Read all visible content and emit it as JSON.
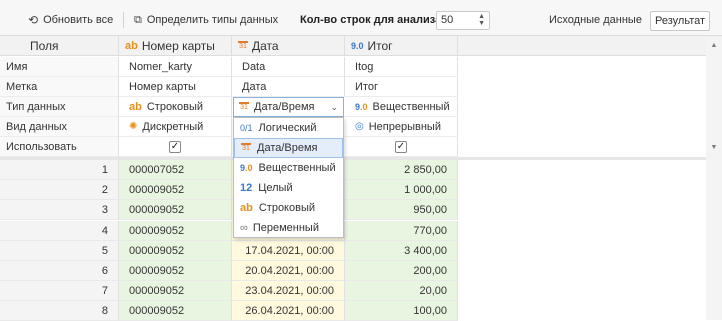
{
  "toolbar": {
    "refresh_label": "Обновить все",
    "detect_label": "Определить типы данных",
    "rows_label": "Кол-во строк для анализа",
    "rows_value": "50",
    "tab_source": "Исходные данные",
    "tab_result": "Результат"
  },
  "header": {
    "fields": "Поля",
    "col1": "Номер карты",
    "col2": "Дата",
    "col3": "Итог",
    "col1_icon": "ab",
    "col2_icon": "31",
    "col3_icon": "9.0"
  },
  "props": {
    "name_label": "Имя",
    "label_label": "Метка",
    "type_label": "Тип данных",
    "kind_label": "Вид данных",
    "use_label": "Использовать",
    "col1": {
      "name": "Nomer_karty",
      "label": "Номер карты",
      "type": "Строковый",
      "kind": "Дискретный"
    },
    "col2": {
      "name": "Data",
      "label": "Дата",
      "type": "Дата/Время"
    },
    "col3": {
      "name": "Itog",
      "label": "Итог",
      "type": "Вещественный",
      "kind": "Непрерывный"
    }
  },
  "dropdown": {
    "selected": "Дата/Время",
    "options": [
      "Логический",
      "Дата/Время",
      "Вещественный",
      "Целый",
      "Строковый",
      "Переменный"
    ]
  },
  "rows": [
    {
      "n": "1",
      "card": "000007052",
      "date": "",
      "total": "2 850,00"
    },
    {
      "n": "2",
      "card": "000009052",
      "date": "",
      "total": "1 000,00"
    },
    {
      "n": "3",
      "card": "000009052",
      "date": "",
      "total": "950,00"
    },
    {
      "n": "4",
      "card": "000009052",
      "date": "",
      "total": "770,00"
    },
    {
      "n": "5",
      "card": "000009052",
      "date": "17.04.2021, 00:00",
      "total": "3 400,00"
    },
    {
      "n": "6",
      "card": "000009052",
      "date": "20.04.2021, 00:00",
      "total": "200,00"
    },
    {
      "n": "7",
      "card": "000009052",
      "date": "23.04.2021, 00:00",
      "total": "20,00"
    },
    {
      "n": "8",
      "card": "000009052",
      "date": "26.04.2021, 00:00",
      "total": "100,00"
    }
  ]
}
